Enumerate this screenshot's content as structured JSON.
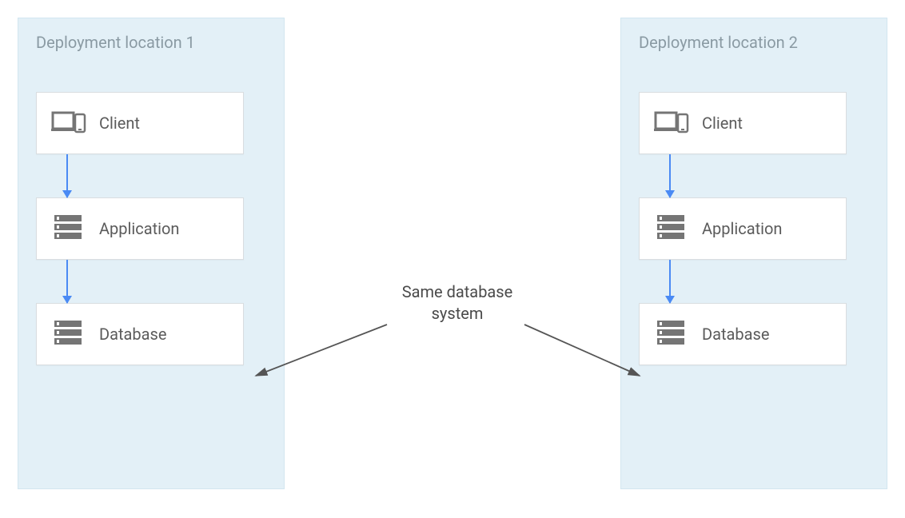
{
  "zones": {
    "left": {
      "title": "Deployment location 1"
    },
    "right": {
      "title": "Deployment location 2"
    }
  },
  "stack": {
    "client": "Client",
    "application": "Application",
    "database": "Database"
  },
  "center_label_line1": "Same database",
  "center_label_line2": "system",
  "colors": {
    "zone_bg": "#e3f0f7",
    "zone_title": "#8a9aa3",
    "box_border": "#d9dde0",
    "box_text": "#5b5b5b",
    "icon_fill": "#757575",
    "flow_arrow": "#4a8af4",
    "diag_arrow": "#555555"
  }
}
